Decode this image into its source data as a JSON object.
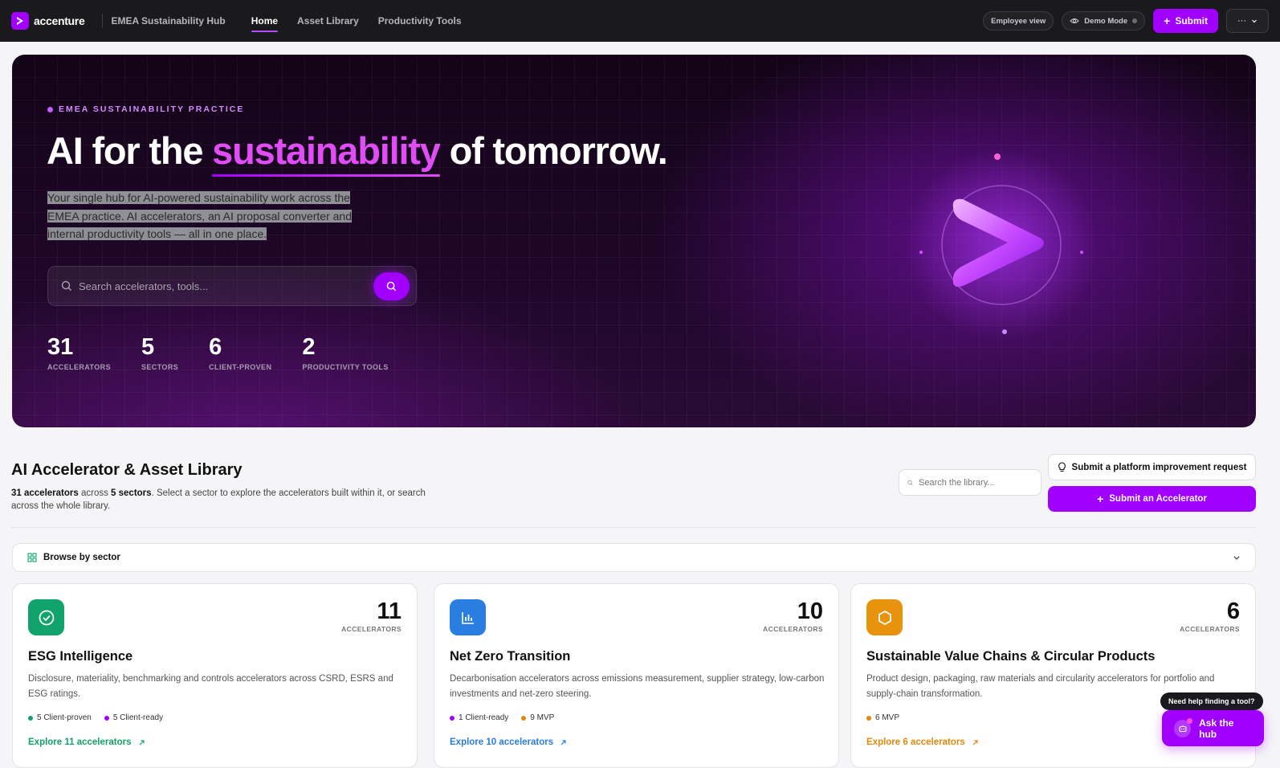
{
  "nav": {
    "brand": "accenture",
    "hub_title": "EMEA Sustainability Hub",
    "tabs": [
      {
        "label": "Home",
        "active": true
      },
      {
        "label": "Asset Library",
        "active": false
      },
      {
        "label": "Productivity Tools",
        "active": false
      }
    ],
    "employee_view": "Employee view",
    "demo_mode": "Demo Mode",
    "submit": "Submit",
    "more": "···"
  },
  "hero": {
    "eyebrow": "EMEA SUSTAINABILITY PRACTICE",
    "title_pre": "AI for the",
    "title_accent": "sustainability",
    "title_post": "of tomorrow.",
    "description": "Your single hub for AI-powered sustainability work across the EMEA practice. AI accelerators, an AI proposal converter and internal productivity tools — all in one place.",
    "search_placeholder": "Search accelerators, tools...",
    "stats": [
      {
        "value": "31",
        "label": "ACCELERATORS"
      },
      {
        "value": "5",
        "label": "SECTORS"
      },
      {
        "value": "6",
        "label": "CLIENT-PROVEN"
      },
      {
        "value": "2",
        "label": "PRODUCTIVITY TOOLS"
      }
    ]
  },
  "library": {
    "title": "AI Accelerator & Asset Library",
    "desc_count": "31 accelerators",
    "desc_mid": "across",
    "desc_sectors": "5 sectors",
    "desc_rest": ". Select a sector to explore the accelerators built within it, or search across the whole library.",
    "search_placeholder": "Search the library...",
    "improve_button": "Submit a platform improvement request",
    "submit_accelerator": "Submit an Accelerator",
    "browse_label": "Browse by sector"
  },
  "cards": [
    {
      "count": "11",
      "count_label": "ACCELERATORS",
      "title": "ESG Intelligence",
      "description": "Disclosure, materiality, benchmarking and controls accelerators across CSRD, ESRS and ESG ratings.",
      "tags": [
        {
          "label": "5 Client-proven",
          "color": "#10a36c"
        },
        {
          "label": "5 Client-ready",
          "color": "#a100ff"
        }
      ],
      "link": "Explore 11 accelerators",
      "accent": "#10a36c",
      "icon": "check-circle-icon"
    },
    {
      "count": "10",
      "count_label": "ACCELERATORS",
      "title": "Net Zero Transition",
      "description": "Decarbonisation accelerators across emissions measurement, supplier strategy, low-carbon investments and net-zero steering.",
      "tags": [
        {
          "label": "1 Client-ready",
          "color": "#a100ff"
        },
        {
          "label": "9 MVP",
          "color": "#e0890a"
        }
      ],
      "link": "Explore 10 accelerators",
      "accent": "#2a7de1",
      "icon": "bar-chart-icon"
    },
    {
      "count": "6",
      "count_label": "ACCELERATORS",
      "title": "Sustainable Value Chains & Circular Products",
      "description": "Product design, packaging, raw materials and circularity accelerators for portfolio and supply-chain transformation.",
      "tags": [
        {
          "label": "6 MVP",
          "color": "#e0890a"
        }
      ],
      "link": "Explore 6 accelerators",
      "accent": "#e8930c",
      "icon": "hexagon-icon"
    }
  ],
  "help": {
    "bubble": "Need help finding a tool?",
    "ask": "Ask the hub"
  }
}
